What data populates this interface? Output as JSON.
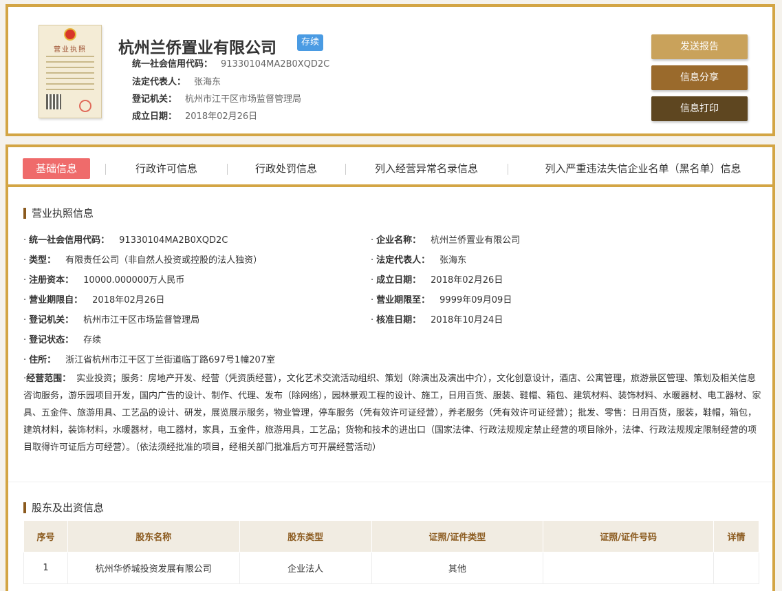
{
  "header": {
    "company_name": "杭州兰侨置业有限公司",
    "status": "存续",
    "license_image_title": "营业执照",
    "meta": [
      {
        "label": "统一社会信用代码：",
        "value": "91330104MA2B0XQD2C"
      },
      {
        "label": "法定代表人：",
        "value": "张海东"
      },
      {
        "label": "登记机关：",
        "value": "杭州市江干区市场监督管理局"
      },
      {
        "label": "成立日期：",
        "value": "2018年02月26日"
      }
    ],
    "buttons": {
      "send": "发送报告",
      "share": "信息分享",
      "print": "信息打印"
    },
    "colors": {
      "border": "#d3a544",
      "status_tag": "#4a9be3",
      "active_tab": "#ef6b6b"
    }
  },
  "tabs": [
    {
      "label": "基础信息",
      "active": true
    },
    {
      "label": "行政许可信息",
      "active": false
    },
    {
      "label": "行政处罚信息",
      "active": false
    },
    {
      "label": "列入经营异常名录信息",
      "active": false
    },
    {
      "label": "列入严重违法失信企业名单（黑名单）信息",
      "active": false
    }
  ],
  "license_section": {
    "title": "营业执照信息",
    "fields": {
      "credit_code": {
        "label": "统一社会信用代码：",
        "value": "91330104MA2B0XQD2C"
      },
      "company_name": {
        "label": "企业名称：",
        "value": "杭州兰侨置业有限公司"
      },
      "type": {
        "label": "类型：",
        "value": "有限责任公司（非自然人投资或控股的法人独资）"
      },
      "legal_rep": {
        "label": "法定代表人：",
        "value": "张海东"
      },
      "capital": {
        "label": "注册资本：",
        "value": "10000.000000万人民币"
      },
      "founded": {
        "label": "成立日期：",
        "value": "2018年02月26日"
      },
      "term_from": {
        "label": "营业期限自：",
        "value": "2018年02月26日"
      },
      "term_to": {
        "label": "营业期限至：",
        "value": "9999年09月09日"
      },
      "authority": {
        "label": "登记机关：",
        "value": "杭州市江干区市场监督管理局"
      },
      "approved": {
        "label": "核准日期：",
        "value": "2018年10月24日"
      },
      "reg_status": {
        "label": "登记状态：",
        "value": "存续"
      },
      "address": {
        "label": "住所：",
        "value": "浙江省杭州市江干区丁兰街道临丁路697号1幢207室"
      },
      "scope": {
        "label": "经营范围：",
        "value": "实业投资；服务：房地产开发、经营（凭资质经营），文化艺术交流活动组织、策划（除演出及演出中介），文化创意设计，酒店、公寓管理，旅游景区管理、策划及相关信息咨询服务，游乐园项目开发，国内广告的设计、制作、代理、发布（除网络），园林景观工程的设计、施工，日用百货、服装、鞋帽、箱包、建筑材料、装饰材料、水暖器材、电工器材、家具、五金件、旅游用具、工艺品的设计、研发，展览展示服务，物业管理，停车服务（凭有效许可证经营），养老服务（凭有效许可证经营）；批发、零售：日用百货，服装，鞋帽，箱包，建筑材料，装饰材料，水暖器材，电工器材，家具，五金件，旅游用具，工艺品；货物和技术的进出口（国家法律、行政法规规定禁止经营的项目除外，法律、行政法规规定限制经营的项目取得许可证后方可经营）。（依法须经批准的项目，经相关部门批准后方可开展经营活动）"
      }
    }
  },
  "shareholder_section": {
    "title": "股东及出资信息",
    "columns": [
      "序号",
      "股东名称",
      "股东类型",
      "证照/证件类型",
      "证照/证件号码",
      "详情"
    ],
    "rows": [
      [
        "1",
        "杭州华侨城投资发展有限公司",
        "企业法人",
        "其他",
        "",
        ""
      ]
    ]
  }
}
